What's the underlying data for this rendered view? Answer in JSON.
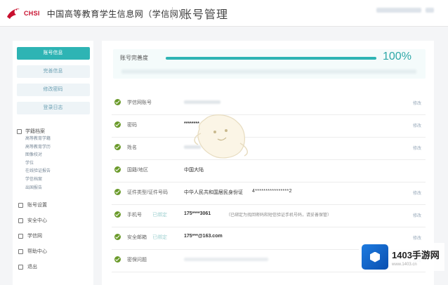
{
  "header": {
    "logo_text": "CHSI",
    "site_name": "中国高等教育学生信息网（学信网）",
    "page_title": "账号管理"
  },
  "sidebar": {
    "buttons": [
      {
        "label": "账号信息"
      },
      {
        "label": "完善信息"
      },
      {
        "label": "修改密码"
      },
      {
        "label": "登录日志"
      }
    ],
    "group": {
      "title": "学籍档案",
      "items": [
        "高等教育学籍",
        "高等教育学历",
        "图像校对",
        "学位",
        "在线验证报告",
        "学信档案",
        "出国报告"
      ]
    },
    "links": [
      {
        "label": "账号设置"
      },
      {
        "label": "安全中心"
      },
      {
        "label": "学信网"
      },
      {
        "label": "帮助中心"
      },
      {
        "label": "退出"
      }
    ]
  },
  "main": {
    "progress": {
      "label": "账号完善度",
      "percent": 100,
      "percent_text": "100%"
    },
    "rows": [
      {
        "label": "学信网账号",
        "value": "",
        "action": "修改"
      },
      {
        "label": "密码",
        "value": "********",
        "action": "修改"
      },
      {
        "label": "姓名",
        "value": "",
        "action": "修改"
      },
      {
        "label": "国籍/地区",
        "value": "中国大陆",
        "action": ""
      },
      {
        "label": "证件类型/证件号码",
        "value": "中华人民共和国居民身份证",
        "value2": "4****************2",
        "action": "修改"
      },
      {
        "label": "手机号",
        "tag": "已绑定",
        "value": "175****3061",
        "desc": "（已绑定为找回密码和短信验证手机号码，请妥善保管）",
        "action": "修改"
      },
      {
        "label": "安全邮箱",
        "tag": "已绑定",
        "value": "175***@163.com",
        "action": "修改"
      },
      {
        "label": "密保问题",
        "value": "",
        "action": "修改"
      }
    ]
  },
  "watermark": {
    "title": "1403手游网",
    "url": "www.1403.cn"
  },
  "colors": {
    "accent": "#2eb4b4",
    "check": "#6a9a2a"
  }
}
